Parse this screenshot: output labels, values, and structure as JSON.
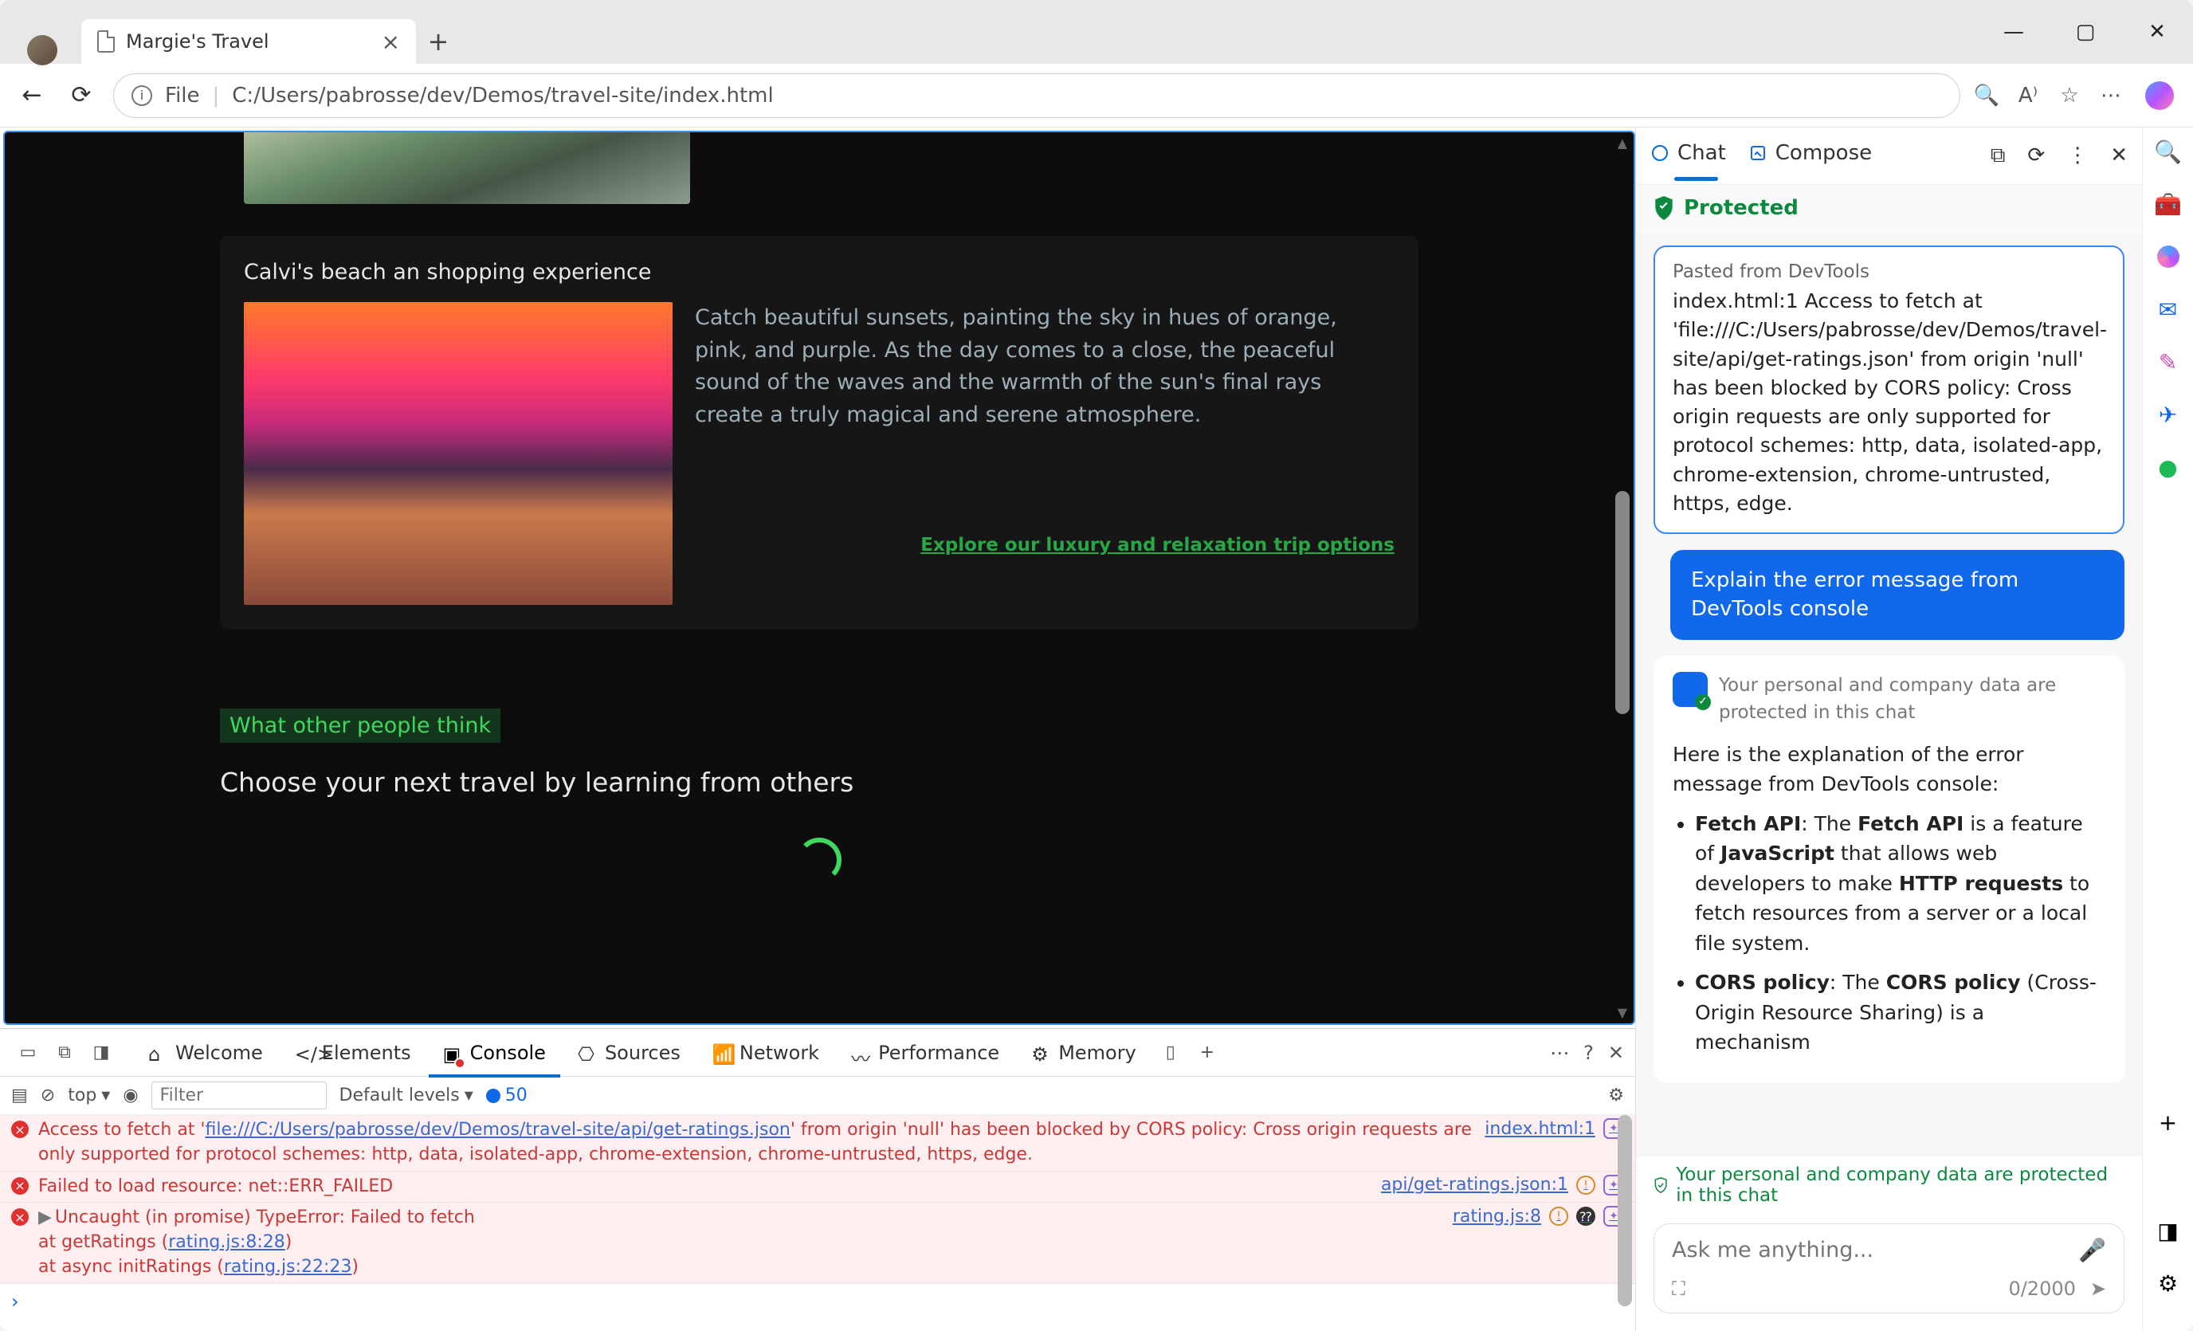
{
  "browser": {
    "tab_title": "Margie's Travel",
    "address_scheme": "File",
    "address_path": "C:/Users/pabrosse/dev/Demos/travel-site/index.html"
  },
  "page": {
    "card_title": "Calvi's beach an shopping experience",
    "card_text": "Catch beautiful sunsets, painting the sky in hues of orange, pink, and purple. As the day comes to a close, the peaceful sound of the waves and the warmth of the sun's final rays create a truly magical and serene atmosphere.",
    "card_link": "Explore our luxury and relaxation trip options",
    "tag": "What other people think",
    "subheading": "Choose your next travel by learning from others"
  },
  "copilot": {
    "tabs": {
      "chat": "Chat",
      "compose": "Compose"
    },
    "protected": "Protected",
    "pasted_hint": "Pasted from DevTools",
    "pasted_text": "index.html:1 Access to fetch at 'file:///C:/Users/pabrosse/dev/Demos/travel-site/api/get-ratings.json' from origin 'null' has been blocked by CORS policy: Cross origin requests are only supported for protocol schemes: http, data, isolated-app, chrome-extension, chrome-untrusted, https, edge.",
    "question": "Explain the error message from DevTools console",
    "notice": "Your personal and company data are protected in this chat",
    "intro": "Here is the explanation of the error message from DevTools console:",
    "bullet1_pre": "Fetch API",
    "bullet1_mid": ": The ",
    "bullet1_b2": "Fetch API",
    "bullet1_mid2": " is a feature of ",
    "bullet1_b3": "JavaScript",
    "bullet1_mid3": " that allows web developers to make ",
    "bullet1_b4": "HTTP requests",
    "bullet1_tail": " to fetch resources from a server or a local file system.",
    "bullet2_pre": "CORS policy",
    "bullet2_mid": ": The ",
    "bullet2_b2": "CORS policy",
    "bullet2_tail": " (Cross-Origin Resource Sharing) is a mechanism",
    "footer_note": "Your personal and company data are protected in this chat",
    "input_placeholder": "Ask me anything...",
    "counter": "0/2000"
  },
  "devtools": {
    "tabs": {
      "welcome": "Welcome",
      "elements": "Elements",
      "console": "Console",
      "sources": "Sources",
      "network": "Network",
      "performance": "Performance",
      "memory": "Memory"
    },
    "filter": {
      "top": "top",
      "placeholder": "Filter",
      "levels": "Default levels",
      "issues": "50"
    },
    "logs": {
      "l1_a": "Access to fetch at '",
      "l1_url": "file:///C:/Users/pabrosse/dev/Demos/travel-site/api/get-ratings.json",
      "l1_b": "' from origin 'null' has been blocked by CORS policy: Cross origin requests are only supported for protocol schemes: http, data, isolated-app, chrome-extension, chrome-untrusted, https, edge.",
      "l1_src": "index.html:1",
      "l2": "Failed to load resource: net::ERR_FAILED",
      "l2_src": "api/get-ratings.json:1",
      "l3a": "Uncaught (in promise) TypeError: Failed to fetch",
      "l3b": "    at getRatings (",
      "l3b_url": "rating.js:8:28",
      "l3c": "    at async initRatings (",
      "l3c_url": "rating.js:22:23",
      "l3_src": "rating.js:8"
    }
  }
}
